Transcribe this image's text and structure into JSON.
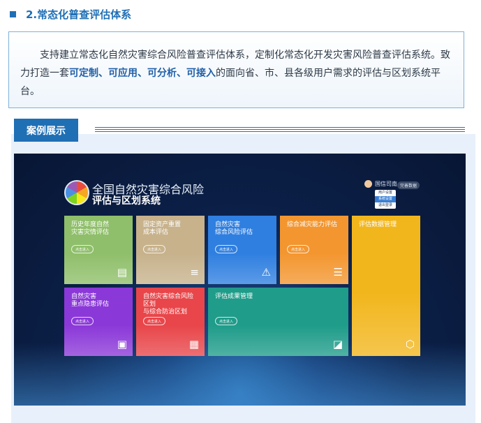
{
  "section": {
    "title": "2.常态化普查评估体系"
  },
  "intro": {
    "part1": "支持建立常态化自然灾害综合风险普查评估体系，定制化常态化开发灾害风险普查评估系统。致力打造一套",
    "bold": "可定制、可应用、可分析、可接入",
    "part2": "的面向省、市、县各级用户需求的评估与区划系统平台。"
  },
  "case": {
    "label": "案例展示"
  },
  "app": {
    "title_line1": "全国自然灾害综合风险",
    "title_line2": "评估与区划系统",
    "user_name": "国信司南 ▾",
    "logout_label": "完善数据",
    "dropdown": [
      "用户设置",
      "系统设置",
      "退出登录"
    ],
    "tiles": [
      {
        "id": "history",
        "title": "历史年度自然\n灾害灾情评估",
        "button": "点击进入",
        "icon": "chart-icon",
        "color": "#8fbf6a"
      },
      {
        "id": "assets",
        "title": "固定资产重置\n成本评估",
        "button": "点击进入",
        "icon": "coins-icon",
        "color": "#c7b28c"
      },
      {
        "id": "hazard",
        "title": "自然灾害\n综合风险评估",
        "button": "点击进入",
        "icon": "warning-icon",
        "color": "#2f7fe0"
      },
      {
        "id": "capacity",
        "title": "综合减灾能力评估",
        "button": "点击进入",
        "icon": "slider-icon",
        "color": "#f3962f"
      },
      {
        "id": "evaldata",
        "title": "评估数据管理",
        "button": "",
        "icon": "network-icon",
        "color": "#f2b61d"
      },
      {
        "id": "hidden",
        "title": "自然灾害\n重点隐患评估",
        "button": "点击进入",
        "icon": "monitor-icon",
        "color": "#8b38d8"
      },
      {
        "id": "zoning",
        "title": "自然灾害综合风险区划\n与综合防治区划",
        "button": "点击进入",
        "icon": "box-icon",
        "color": "#e8464a"
      },
      {
        "id": "results",
        "title": "评估成果管理",
        "button": "点击进入",
        "icon": "analytics-icon",
        "color": "#1f9c8a"
      }
    ]
  }
}
